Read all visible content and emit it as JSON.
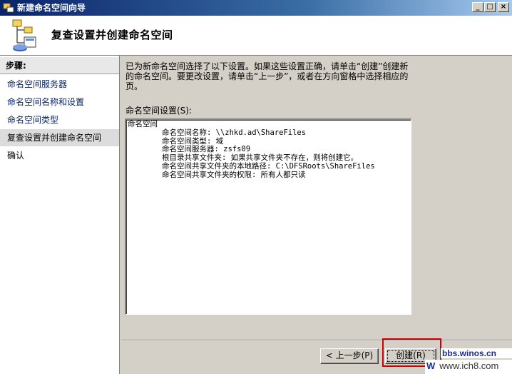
{
  "window": {
    "title": "新建命名空间向导",
    "minimize": "_",
    "maximize": "□",
    "close": "×"
  },
  "header": {
    "heading": "复查设置并创建命名空间"
  },
  "sidebar": {
    "title": "步骤:",
    "steps": [
      "命名空间服务器",
      "命名空间名称和设置",
      "命名空间类型",
      "复查设置并创建命名空间",
      "确认"
    ]
  },
  "main": {
    "description": "已为新命名空间选择了以下设置。如果这些设置正确，请单击“创建”创建新的命名空间。要更改设置，请单击“上一步”，或者在方向窗格中选择相应的页。",
    "settings_label": "命名空间设置(S):",
    "settings_lines": [
      "命名空间",
      "命名空间名称: \\\\zhkd.ad\\ShareFiles",
      "命名空间类型: 域",
      "命名空间服务器: zsfs09",
      "根目录共享文件夹: 如果共享文件夹不存在，则将创建它。",
      "命名空间共享文件夹的本地路径: C:\\DFSRoots\\ShareFiles",
      "命名空间共享文件夹的权限: 所有人都只读"
    ]
  },
  "buttons": {
    "back": "< 上一步(P)",
    "create": "创建(R)"
  },
  "watermark": {
    "line1": "bbs.winos.cn",
    "w": "W",
    "line2": "www.ich8.com"
  }
}
